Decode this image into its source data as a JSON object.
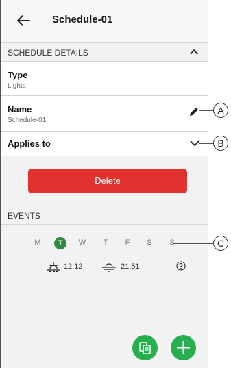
{
  "header": {
    "title": "Schedule-01"
  },
  "details": {
    "section_label": "SCHEDULE DETAILS",
    "type": {
      "label": "Type",
      "value": "Lights"
    },
    "name": {
      "label": "Name",
      "value": "Schedule-01"
    },
    "applies_to": {
      "label": "Applies to"
    }
  },
  "delete_label": "Delete",
  "events": {
    "section_label": "EVENTS",
    "days": [
      "M",
      "T",
      "W",
      "T",
      "F",
      "S",
      "S"
    ],
    "selected_day_index": 1,
    "sunrise_time": "12:12",
    "sunset_time": "21:51"
  },
  "callouts": {
    "a": "A",
    "b": "B",
    "c": "C"
  },
  "colors": {
    "accent_green": "#2e8b3e",
    "fab_green": "#27ae4f",
    "delete_red": "#e2322f"
  }
}
